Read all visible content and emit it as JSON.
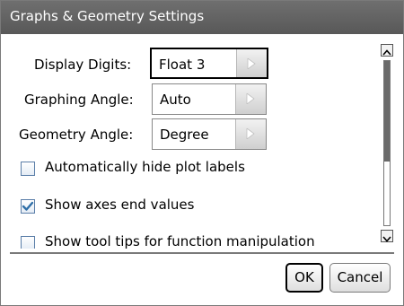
{
  "dialog": {
    "title": "Graphs & Geometry Settings"
  },
  "settings": {
    "display_digits": {
      "label": "Display Digits:",
      "value": "Float 3"
    },
    "graphing_angle": {
      "label": "Graphing Angle:",
      "value": "Auto"
    },
    "geometry_angle": {
      "label": "Geometry Angle:",
      "value": "Degree"
    }
  },
  "options": [
    {
      "label": "Automatically hide plot labels",
      "checked": false
    },
    {
      "label": "Show axes end values",
      "checked": true
    },
    {
      "label": "Show tool tips for function manipulation",
      "checked": false
    }
  ],
  "buttons": {
    "ok": "OK",
    "cancel": "Cancel"
  },
  "colors": {
    "titlebar": "#5e5e5e",
    "checkmark": "#2f6fa8"
  },
  "icons": {
    "dropdown_arrow": "triangle-right-icon",
    "scroll_up": "chevron-up-icon",
    "scroll_down": "chevron-down-icon",
    "check": "checkmark-icon"
  }
}
